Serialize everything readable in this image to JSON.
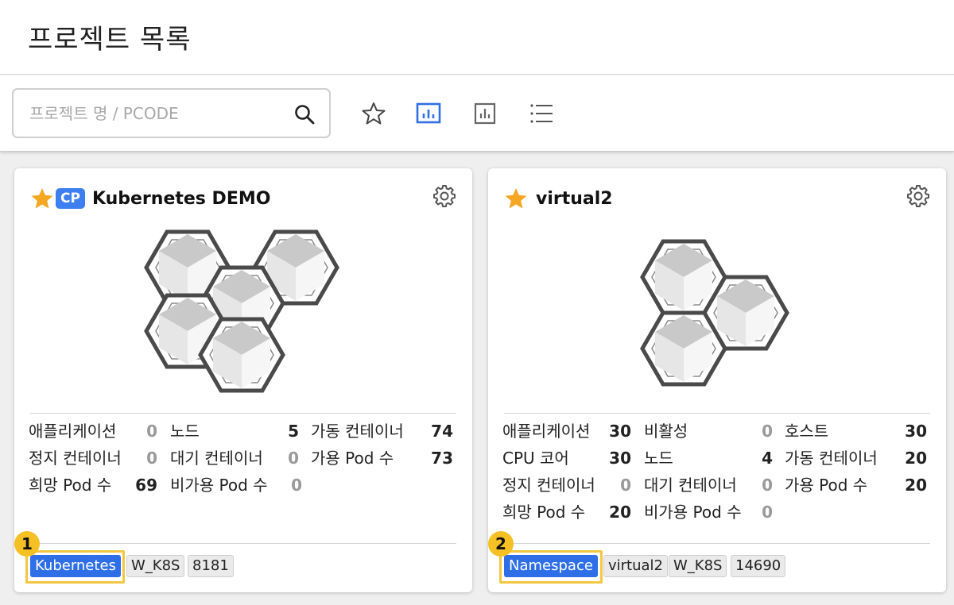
{
  "page_title": "프로젝트 목록",
  "search": {
    "placeholder": "프로젝트 명 / PCODE",
    "value": ""
  },
  "view_buttons": [
    {
      "icon": "star-outline-icon",
      "active": false
    },
    {
      "icon": "bar-chart-box-icon",
      "active": true
    },
    {
      "icon": "bar-chart-box-icon",
      "active": false
    },
    {
      "icon": "list-icon",
      "active": false
    }
  ],
  "colors": {
    "accent_blue": "#2e6fe8",
    "cp_badge": "#3d7ff0",
    "star": "#f5a623",
    "highlight": "#f3c743",
    "badge": "#f5c024"
  },
  "cards": [
    {
      "starred": true,
      "badge": "CP",
      "title": "Kubernetes DEMO",
      "stats": [
        {
          "label": "애플리케이션",
          "value": "0"
        },
        {
          "label": "노드",
          "value": "5"
        },
        {
          "label": "가동 컨테이너",
          "value": "74"
        },
        {
          "label": "정지 컨테이너",
          "value": "0"
        },
        {
          "label": "대기 컨테이너",
          "value": "0"
        },
        {
          "label": "가용 Pod 수",
          "value": "73"
        },
        {
          "label": "희망 Pod 수",
          "value": "69"
        },
        {
          "label": "비가용 Pod 수",
          "value": "0"
        }
      ],
      "tags": [
        "Kubernetes",
        "W_K8S",
        "8181"
      ],
      "callout": "1"
    },
    {
      "starred": true,
      "title": "virtual2",
      "stats": [
        {
          "label": "애플리케이션",
          "value": "30"
        },
        {
          "label": "비활성",
          "value": "0"
        },
        {
          "label": "호스트",
          "value": "30"
        },
        {
          "label": "CPU 코어",
          "value": "30"
        },
        {
          "label": "노드",
          "value": "4"
        },
        {
          "label": "가동 컨테이너",
          "value": "20"
        },
        {
          "label": "정지 컨테이너",
          "value": "0"
        },
        {
          "label": "대기 컨테이너",
          "value": "0"
        },
        {
          "label": "가용 Pod 수",
          "value": "20"
        },
        {
          "label": "희망 Pod 수",
          "value": "20"
        },
        {
          "label": "비가용 Pod 수",
          "value": "0"
        }
      ],
      "tags": [
        "Namespace",
        "virtual2",
        "W_K8S",
        "14690"
      ],
      "callout": "2"
    }
  ]
}
